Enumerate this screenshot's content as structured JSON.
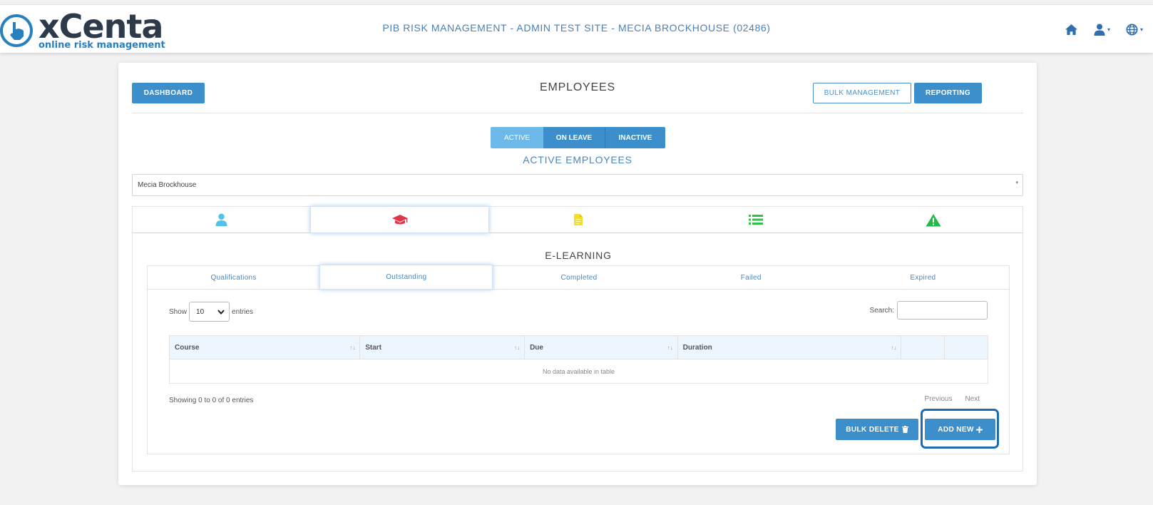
{
  "header": {
    "logo_word": "xCenta",
    "logo_tagline": "online risk management",
    "site_title": "PIB RISK MANAGEMENT - ADMIN TEST SITE - MECIA BROCKHOUSE (02486)",
    "nav": [
      {
        "icon": "home-icon"
      },
      {
        "icon": "user-icon",
        "dropdown_caret": "▾"
      },
      {
        "icon": "globe-icon",
        "dropdown_caret": "▾"
      }
    ]
  },
  "toolbar": {
    "dashboard_label": "DASHBOARD",
    "page_title": "EMPLOYEES",
    "bulk_management_label": "BULK MANAGEMENT",
    "reporting_label": "REPORTING"
  },
  "status_tabs": [
    {
      "label": "ACTIVE",
      "active": true
    },
    {
      "label": "ON LEAVE",
      "active": false
    },
    {
      "label": "INACTIVE",
      "active": false
    }
  ],
  "section_title": "ACTIVE EMPLOYEES",
  "employee_select": {
    "value": "Mecia Brockhouse",
    "caret": "▾"
  },
  "icon_tabs": [
    {
      "icon": "user-icon",
      "color": "#4fc3e8",
      "selected": false
    },
    {
      "icon": "graduation-cap-icon",
      "color": "#e0344a",
      "selected": true
    },
    {
      "icon": "document-icon",
      "color": "#f2dc2e",
      "selected": false
    },
    {
      "icon": "list-icon",
      "color": "#2ec24a",
      "selected": false
    },
    {
      "icon": "warning-icon",
      "color": "#22b84a",
      "selected": false
    }
  ],
  "panel": {
    "title": "E-LEARNING",
    "tabs": [
      {
        "label": "Qualifications",
        "selected": false
      },
      {
        "label": "Outstanding",
        "selected": true
      },
      {
        "label": "Completed",
        "selected": false
      },
      {
        "label": "Failed",
        "selected": false
      },
      {
        "label": "Expired",
        "selected": false
      }
    ]
  },
  "datatable": {
    "show_label": "Show",
    "length_value": "10",
    "entries_label": "entries",
    "search_label": "Search:",
    "columns": [
      {
        "label": "Course",
        "sort": "↑↓"
      },
      {
        "label": "Start",
        "sort": "↑↓"
      },
      {
        "label": "Due",
        "sort": "↑↓"
      },
      {
        "label": "Duration",
        "sort": "↑↓"
      },
      {
        "label": "",
        "sort": ""
      },
      {
        "label": "",
        "sort": ""
      }
    ],
    "empty_message": "No data available in table",
    "info": "Showing 0 to 0 of 0 entries",
    "previous_label": "Previous",
    "next_label": "Next"
  },
  "actions": {
    "bulk_delete_label": "BULK DELETE",
    "add_new_label": "ADD NEW"
  },
  "colors": {
    "primary": "#3d8fcc",
    "active_status": "#6cb9ea",
    "highlight_border": "#1f6bb0"
  }
}
